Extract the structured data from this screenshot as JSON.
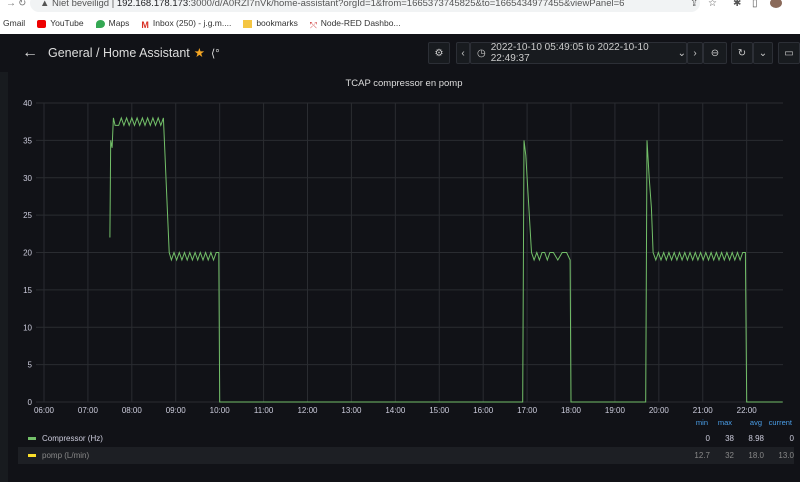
{
  "browser": {
    "security": "Niet beveiligd",
    "url_host": "192.168.178.173",
    "url_rest": ":3000/d/A0RZI7nVk/home-assistant?orgId=1&from=1665373745825&to=1665434977455&viewPanel=6",
    "bookmarks": [
      "Gmail",
      "YouTube",
      "Maps",
      "Inbox (250) - j.g.m....",
      "bookmarks",
      "Node-RED Dashbo..."
    ]
  },
  "header": {
    "folder": "General",
    "separator": "/",
    "title": "Home Assistant",
    "time_range": "2022-10-10 05:49:05 to 2022-10-10 22:49:37"
  },
  "colors": {
    "compressor": "#73bf69",
    "pomp": "#fade2a",
    "accent": "#4a9ee8"
  },
  "legend": {
    "headers": [
      "min",
      "max",
      "avg",
      "current"
    ],
    "rows": [
      {
        "name": "Compressor (Hz)",
        "min": "0",
        "max": "38",
        "avg": "8.98",
        "current": "0"
      },
      {
        "name": "pomp (L/min)",
        "min": "12.7",
        "max": "32",
        "avg": "18.0",
        "current": "13.0"
      }
    ]
  },
  "chart_data": {
    "type": "line",
    "title": "TCAP compressor en pomp",
    "xlabel": "",
    "ylabel": "",
    "xlim": [
      5.818,
      22.827
    ],
    "ylim": [
      0,
      40
    ],
    "grid": true,
    "xticks": [
      "06:00",
      "07:00",
      "08:00",
      "09:00",
      "10:00",
      "11:00",
      "12:00",
      "13:00",
      "14:00",
      "15:00",
      "16:00",
      "17:00",
      "18:00",
      "19:00",
      "20:00",
      "21:00",
      "22:00"
    ],
    "yticks": [
      0,
      5,
      10,
      15,
      20,
      25,
      30,
      35,
      40
    ],
    "series": [
      {
        "name": "Compressor (Hz)",
        "x": [
          7.5,
          7.52,
          7.55,
          7.58,
          7.62,
          7.7,
          7.76,
          7.82,
          7.88,
          7.94,
          8.0,
          8.06,
          8.12,
          8.18,
          8.24,
          8.3,
          8.36,
          8.42,
          8.48,
          8.54,
          8.6,
          8.66,
          8.72,
          8.85,
          8.9,
          8.96,
          9.02,
          9.08,
          9.14,
          9.2,
          9.26,
          9.32,
          9.38,
          9.44,
          9.5,
          9.56,
          9.62,
          9.68,
          9.74,
          9.8,
          9.86,
          9.92,
          9.98,
          10.0,
          16.9,
          16.93,
          16.97,
          17.1,
          17.16,
          17.22,
          17.28,
          17.34,
          17.4,
          17.46,
          17.52,
          17.6,
          17.7,
          17.8,
          17.9,
          17.98,
          18.0,
          19.7,
          19.73,
          19.78,
          19.83,
          19.87,
          19.93,
          19.99,
          20.05,
          20.11,
          20.17,
          20.23,
          20.29,
          20.35,
          20.41,
          20.47,
          20.53,
          20.59,
          20.65,
          20.71,
          20.77,
          20.83,
          20.89,
          20.95,
          21.01,
          21.07,
          21.13,
          21.19,
          21.25,
          21.31,
          21.37,
          21.43,
          21.49,
          21.55,
          21.61,
          21.67,
          21.73,
          21.79,
          21.85,
          21.91,
          21.97,
          22.0,
          22.82
        ],
        "y": [
          22,
          35,
          34,
          38,
          37,
          37,
          38,
          37,
          38,
          37,
          38,
          37,
          38,
          37,
          38,
          37,
          38,
          37,
          38,
          37,
          38,
          37,
          38,
          20,
          19,
          20,
          19,
          20,
          19,
          20,
          19,
          20,
          19,
          20,
          19,
          20,
          19,
          20,
          19,
          20,
          19,
          20,
          20,
          0,
          0,
          35,
          33,
          20,
          19,
          20,
          19,
          20,
          20,
          19,
          20,
          20,
          19,
          20,
          20,
          19,
          0,
          0,
          35,
          30,
          26,
          20,
          19,
          20,
          19,
          20,
          19,
          20,
          19,
          20,
          19,
          20,
          19,
          20,
          19,
          20,
          19,
          20,
          19,
          20,
          19,
          20,
          19,
          20,
          19,
          20,
          19,
          20,
          19,
          20,
          19,
          20,
          19,
          20,
          19,
          20,
          20,
          0,
          0
        ]
      },
      {
        "name": "pomp (L/min)",
        "hidden": true,
        "x": [],
        "y": []
      }
    ]
  }
}
